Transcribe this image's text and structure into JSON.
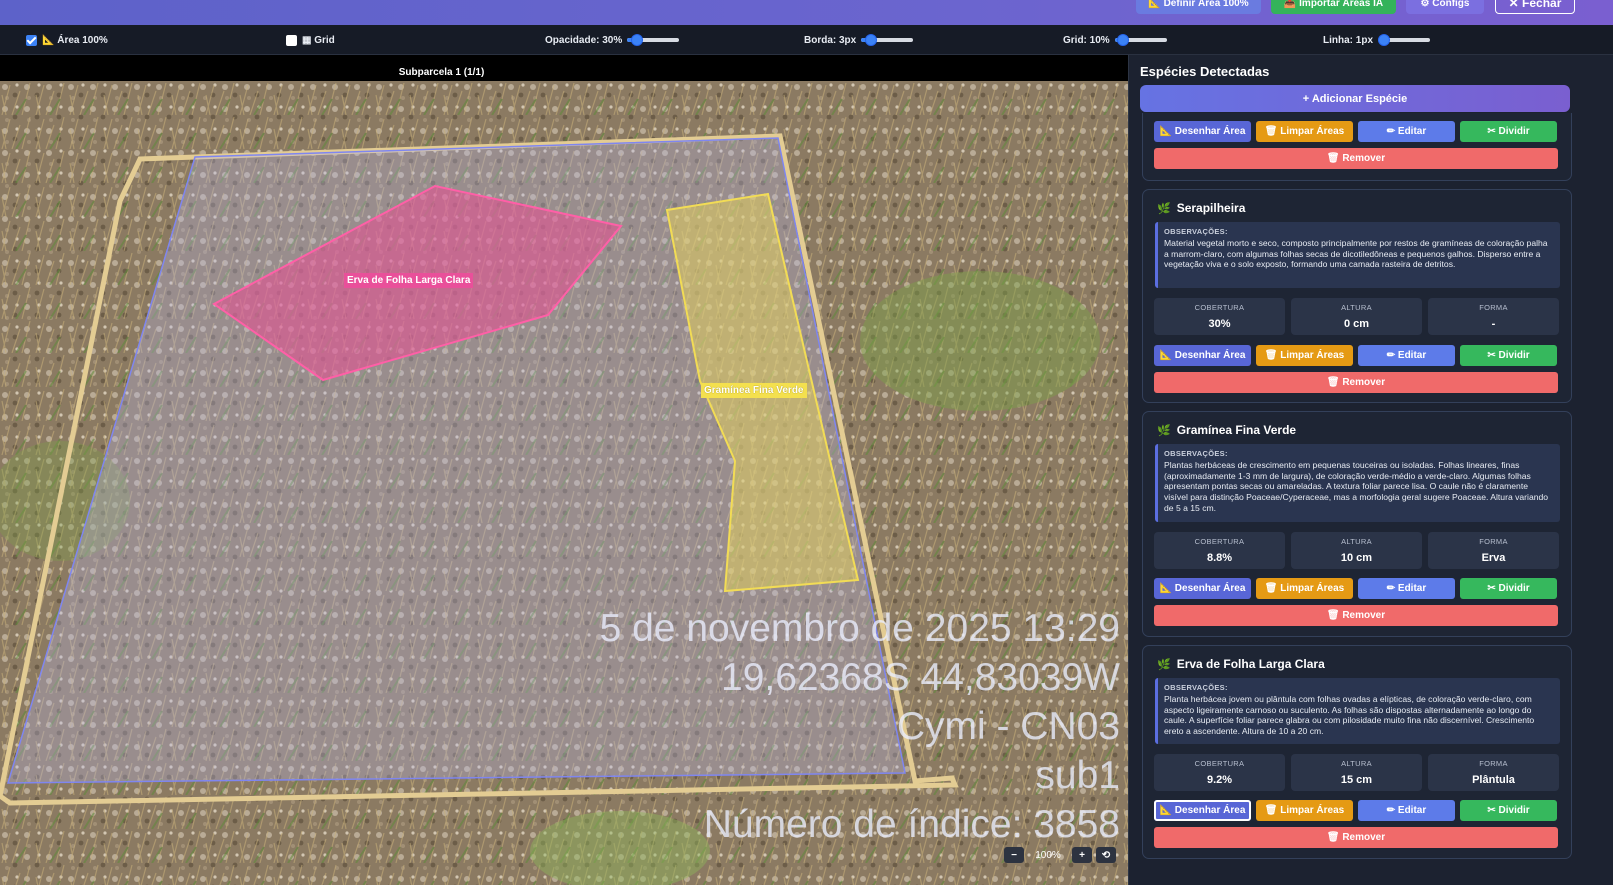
{
  "top_buttons": {
    "define_area": "📐 Definir Área 100%",
    "import_ai": "📥 Importar Áreas IA",
    "configs": "⚙ Configs",
    "close": "✕ Fechar"
  },
  "toolbar": {
    "area_label": "📐 Área 100%",
    "area_checked": true,
    "grid_label": "▦ Grid",
    "grid_checked": false,
    "opacity_label": "Opacidade: 30%",
    "opacity_value": 0.3,
    "border_label": "Borda: 3px",
    "grid_size_label": "Grid: 10%",
    "line_label": "Linha: 1px"
  },
  "viewer": {
    "subparcel_title": "Subparcela 1 (1/1)",
    "photo_overlay": [
      "5 de novembro de 2025 13:29",
      "19,62368S 44,83039W",
      "Cymi - CN03",
      "sub1",
      "Número de índice: 3858"
    ],
    "polygon_labels": {
      "pink": "Erva de Folha Larga Clara",
      "yellow": "Gramínea Fina Verde"
    },
    "zoom": {
      "minus": "−",
      "level": "100%",
      "plus": "+",
      "reset": "⟲"
    }
  },
  "panel": {
    "title": "Espécies Detectadas",
    "add_button": "+ Adicionar Espécie",
    "buttons": {
      "draw": "📐 Desenhar Área",
      "clear": "🗑 Limpar Áreas",
      "edit": "✏ Editar",
      "split": "✂ Dividir",
      "remove": "🗑 Remover"
    },
    "obs_label": "OBSERVAÇÕES:",
    "stat_labels": {
      "cover": "COBERTURA",
      "height": "ALTURA",
      "form": "FORMA"
    },
    "species": [
      {
        "name": "Serapilheira",
        "obs": "Material vegetal morto e seco, composto principalmente por restos de gramíneas de coloração palha a marrom-claro, com algumas folhas secas de dicotiledôneas e pequenos galhos. Disperso entre a vegetação viva e o solo exposto, formando uma camada rasteira de detritos.",
        "cover": "30%",
        "height": "0 cm",
        "form": "-"
      },
      {
        "name": "Gramínea Fina Verde",
        "obs": "Plantas herbáceas de crescimento em pequenas touceiras ou isoladas. Folhas lineares, finas (aproximadamente 1-3 mm de largura), de coloração verde-médio a verde-claro. Algumas folhas apresentam pontas secas ou amareladas. A textura foliar parece lisa. O caule não é claramente visível para distinção Poaceae/Cyperaceae, mas a morfologia geral sugere Poaceae. Altura variando de 5 a 15 cm.",
        "cover": "8.8%",
        "height": "10 cm",
        "form": "Erva"
      },
      {
        "name": "Erva de Folha Larga Clara",
        "obs": "Planta herbácea jovem ou plântula com folhas ovadas a elípticas, de coloração verde-claro, com aspecto ligeiramente carnoso ou suculento. As folhas são dispostas alternadamente ao longo do caule. A superfície foliar parece glabra ou com pilosidade muito fina não discernível. Crescimento ereto a ascendente. Altura de 10 a 20 cm.",
        "cover": "9.2%",
        "height": "15 cm",
        "form": "Plântula"
      }
    ]
  }
}
